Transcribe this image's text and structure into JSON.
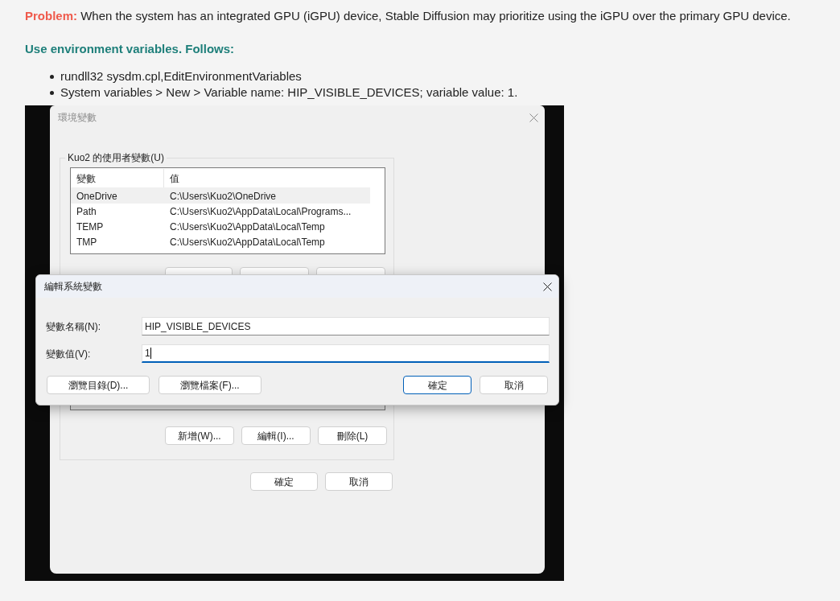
{
  "article": {
    "problem_label": "Problem:",
    "problem_text": "When the system has an integrated GPU (iGPU) device, Stable Diffusion may prioritize using the iGPU over the primary GPU device.",
    "heading": "Use environment variables. Follows:",
    "steps": [
      "rundll32 sysdm.cpl,EditEnvironmentVariables",
      "System variables > New > Variable name: HIP_VISIBLE_DEVICES; variable value: 1."
    ]
  },
  "screenshot": {
    "env_window": {
      "title": "環境變數",
      "user_group": {
        "label": "Kuo2 的使用者變數(U)",
        "columns": [
          "變數",
          "值"
        ],
        "rows": [
          {
            "name": "OneDrive",
            "value": "C:\\Users\\Kuo2\\OneDrive",
            "selected": true
          },
          {
            "name": "Path",
            "value": "C:\\Users\\Kuo2\\AppData\\Local\\Programs...",
            "selected": false
          },
          {
            "name": "TEMP",
            "value": "C:\\Users\\Kuo2\\AppData\\Local\\Temp",
            "selected": false
          },
          {
            "name": "TMP",
            "value": "C:\\Users\\Kuo2\\AppData\\Local\\Temp",
            "selected": false
          }
        ]
      },
      "system_group": {
        "buttons": [
          "新增(W)...",
          "編輯(I)...",
          "刪除(L)"
        ]
      },
      "buttons": [
        "確定",
        "取消"
      ]
    },
    "edit_dialog": {
      "title": "編輯系統變數",
      "fields": [
        {
          "label": "變數名稱(N):",
          "value": "HIP_VISIBLE_DEVICES",
          "focused": false
        },
        {
          "label": "變數值(V):",
          "value": "1",
          "focused": true
        }
      ],
      "left_buttons": [
        "瀏覽目錄(D)...",
        "瀏覽檔案(F)..."
      ],
      "right_buttons": [
        {
          "label": "確定",
          "default": true
        },
        {
          "label": "取消",
          "default": false
        }
      ]
    }
  }
}
